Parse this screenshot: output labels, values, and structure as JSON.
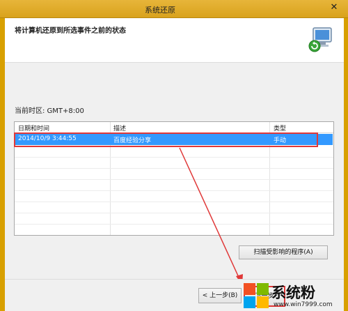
{
  "window": {
    "title": "系统还原",
    "close_glyph": "✕"
  },
  "header": {
    "heading": "将计算机还原到所选事件之前的状态",
    "logo_icon": "system-restore-icon"
  },
  "timezone_label": "当前时区: GMT+8:00",
  "table": {
    "columns": [
      "日期和时间",
      "描述",
      "类型"
    ],
    "rows": [
      {
        "date": "2014/10/9 3:44:55",
        "description": "百度经验分享",
        "type": "手动",
        "selected": true
      }
    ]
  },
  "buttons": {
    "scan": "扫描受影响的程序(A)",
    "back": "< 上一步(B)",
    "next": "下一步"
  },
  "watermark": {
    "text": "系统粉",
    "url": "www.win7999.com"
  },
  "colors": {
    "selection": "#3399ff",
    "annotation": "#e03838",
    "titlebar": "#d9a21c"
  }
}
